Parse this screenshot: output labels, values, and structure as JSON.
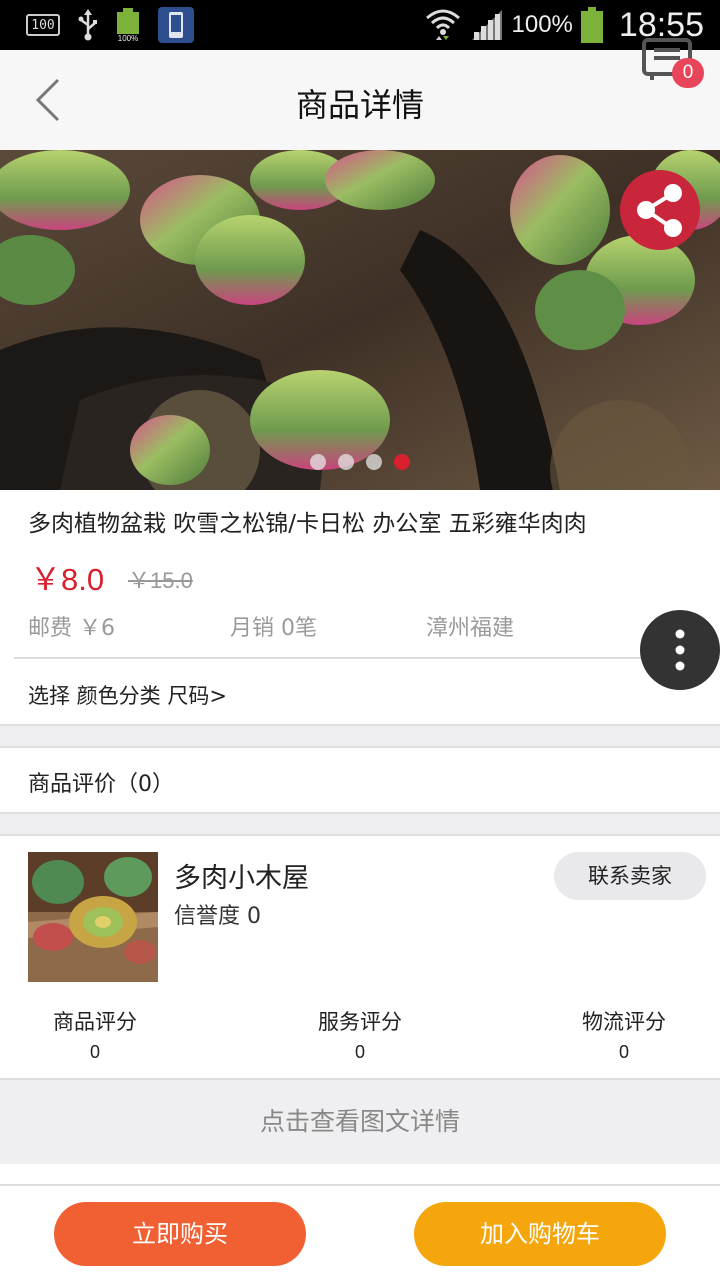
{
  "status_bar": {
    "indicator_box": "100",
    "battery_small_label": "100%",
    "battery_percent": "100%",
    "time": "18:55"
  },
  "header": {
    "title": "商品详情",
    "cart_count": "0"
  },
  "banner": {
    "dot_count": 4,
    "active_index": 3
  },
  "product": {
    "title": "多肉植物盆栽 吹雪之松锦/卡日松 办公室 五彩雍华肉肉",
    "price": "￥8.0",
    "original_price": "￥15.0",
    "shipping": "邮费 ￥6",
    "monthly_sales": "月销 0笔",
    "location": "漳州福建",
    "select_label": "选择 颜色分类 尺码>"
  },
  "reviews": {
    "label": "商品评价（0）"
  },
  "shop": {
    "name": "多肉小木屋",
    "credit": "信誉度 0",
    "contact_label": "联系卖家",
    "ratings": [
      {
        "label": "商品评分",
        "value": "0"
      },
      {
        "label": "服务评分",
        "value": "0"
      },
      {
        "label": "物流评分",
        "value": "0"
      }
    ]
  },
  "detail_link": "点击查看图文详情",
  "actions": {
    "buy_now": "立即购买",
    "add_to_cart": "加入购物车"
  },
  "colors": {
    "accent_red": "#d9202e",
    "buy_orange": "#f06033",
    "cart_yellow": "#f5a60c",
    "badge_pink": "#e8455a"
  }
}
